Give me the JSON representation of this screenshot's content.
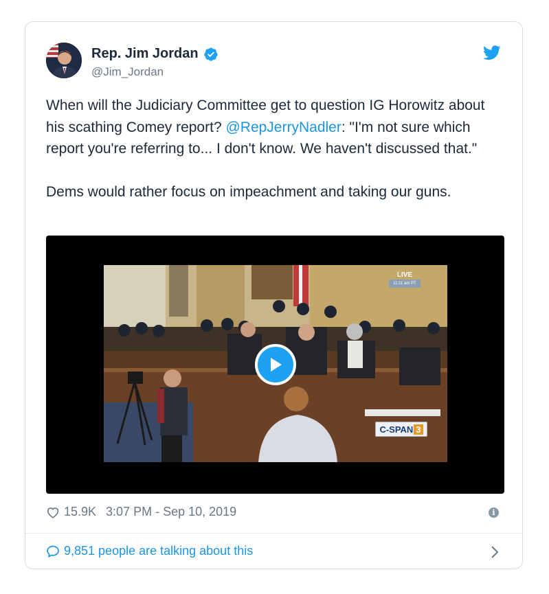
{
  "tweet": {
    "display_name": "Rep. Jim Jordan",
    "handle": "@Jim_Jordan",
    "text_part1": "When will the Judiciary Committee get to question IG Horowitz about his scathing Comey report? ",
    "mention": "@RepJerryNadler",
    "text_part2": ": \"I'm not sure which report you're referring to... I don't know. We haven't discussed that.\"",
    "text_para2": "Dems would rather focus on impeachment and taking our guns.",
    "likes": "15.9K",
    "timestamp": "3:07 PM - Sep 10, 2019",
    "talking": "9,851 people are talking about this"
  },
  "video": {
    "live_label": "LIVE",
    "live_time": "11:11 am PT",
    "network_label": "C-SPAN",
    "network_channel": "3"
  },
  "icons": {
    "verified": "verified-badge-icon",
    "bird": "twitter-bird-icon",
    "play": "play-icon",
    "heart": "heart-icon",
    "info": "info-icon",
    "comment": "comment-bubble-icon",
    "chevron": "chevron-right-icon"
  },
  "colors": {
    "accent": "#1da1f2",
    "link": "#1b95e0",
    "text": "#1c2938",
    "muted": "#6a7784"
  }
}
